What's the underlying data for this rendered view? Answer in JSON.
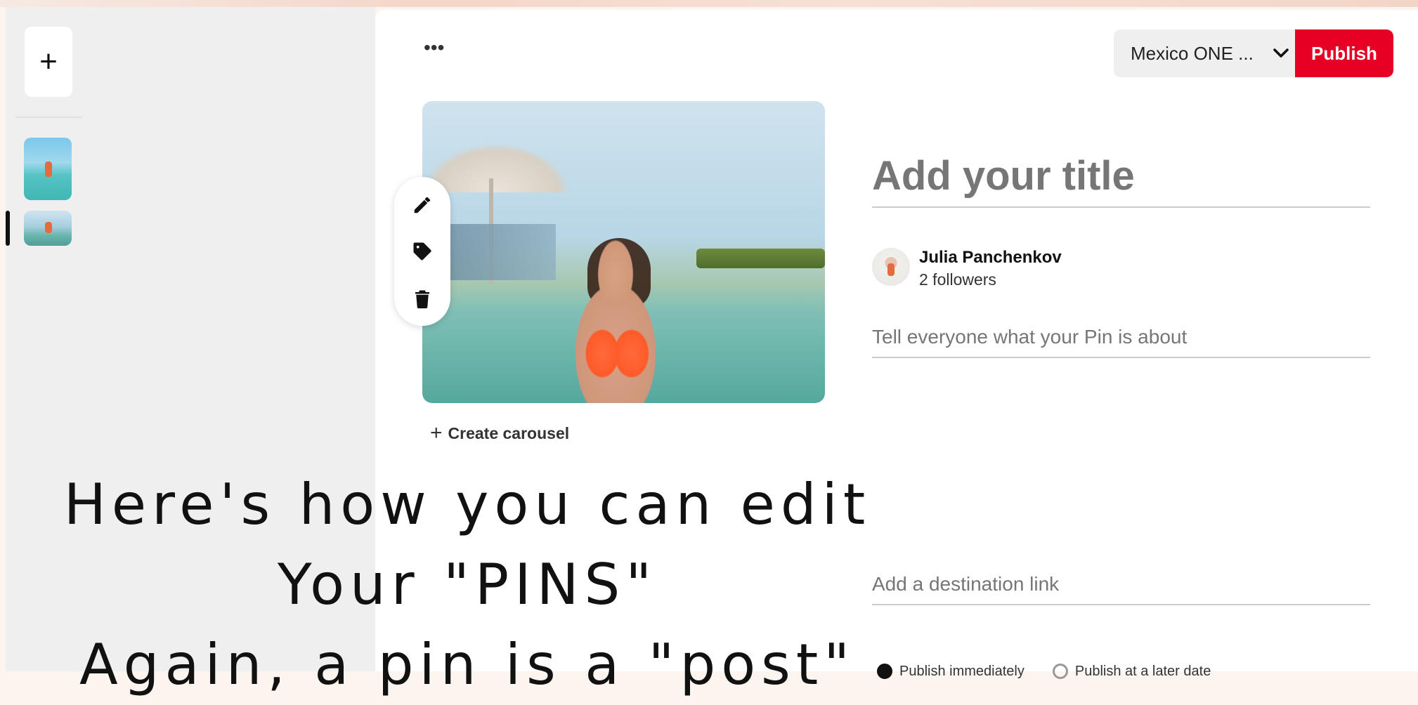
{
  "toolbar": {
    "add_label": "+",
    "more_label": "•••",
    "board_selected": "Mexico ONE ...",
    "board_chevron": "⌄",
    "publish_label": "Publish"
  },
  "pin": {
    "create_carousel_plus": "+",
    "create_carousel_label": "Create carousel",
    "title_placeholder": "Add your title",
    "about_placeholder": "Tell everyone what your Pin is about",
    "link_placeholder": "Add a destination link"
  },
  "user": {
    "name": "Julia Panchenkov",
    "followers": "2 followers"
  },
  "publish_options": {
    "immediately": "Publish immediately",
    "later": "Publish at a later date"
  },
  "overlay": {
    "line1": "Here's how you can edit",
    "line2": "Your \"PINS\"",
    "line3": "Again, a pin is a \"post\""
  },
  "colors": {
    "brand_red": "#e60023",
    "panel_gray": "#efefef"
  },
  "icons": [
    "pencil-icon",
    "tag-icon",
    "trash-icon",
    "chevron-down-icon",
    "more-icon",
    "plus-icon"
  ]
}
